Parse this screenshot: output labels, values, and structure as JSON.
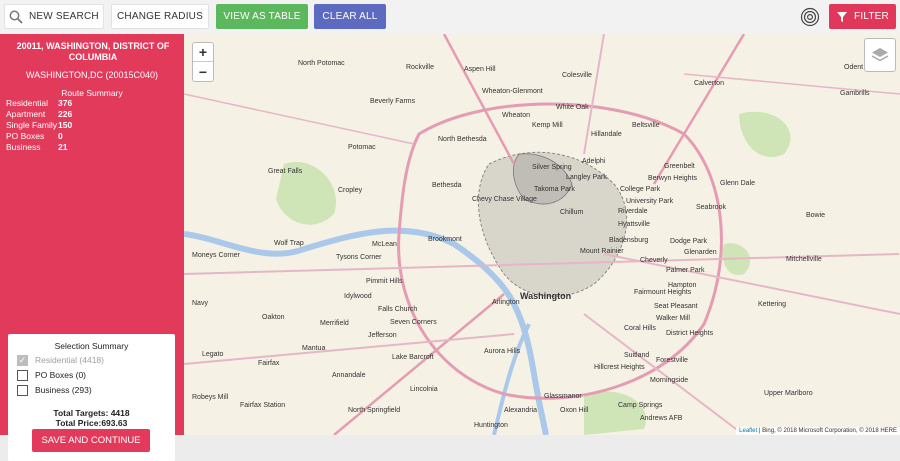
{
  "toolbar": {
    "new_search": "NEW SEARCH",
    "change_radius": "CHANGE RADIUS",
    "view_as_table": "VIEW AS TABLE",
    "clear_all": "CLEAR ALL",
    "filter": "FILTER"
  },
  "sidebar": {
    "address_title": "20011, WASHINGTON, DISTRICT OF COLUMBIA",
    "address_sub": "WASHINGTON,DC (20015C040)",
    "route_summary_title": "Route Summary",
    "routes": [
      {
        "label": "Residential",
        "value": "376"
      },
      {
        "label": "Apartment",
        "value": "226"
      },
      {
        "label": "Single Family",
        "value": "150"
      },
      {
        "label": "PO Boxes",
        "value": "0"
      },
      {
        "label": "Business",
        "value": "21"
      }
    ]
  },
  "selection": {
    "title": "Selection Summary",
    "items": [
      {
        "label": "Residential (4418)",
        "checked": true,
        "disabled": true
      },
      {
        "label": "PO Boxes (0)",
        "checked": false,
        "disabled": false
      },
      {
        "label": "Business (293)",
        "checked": false,
        "disabled": false
      }
    ],
    "total_targets": "Total Targets: 4418",
    "total_price": "Total Price:693.63",
    "save_button": "SAVE AND CONTINUE"
  },
  "map": {
    "zoom_in": "+",
    "zoom_out": "−",
    "attribution_leaflet": "Leaflet",
    "attribution_rest": " | Bing, © 2018 Microsoft Corporation, © 2018 HERE",
    "places": [
      {
        "name": "North Potomac",
        "big": false
      },
      {
        "name": "Rockville",
        "big": false
      },
      {
        "name": "Aspen Hill",
        "big": false
      },
      {
        "name": "Colesville",
        "big": false
      },
      {
        "name": "Calverton",
        "big": false
      },
      {
        "name": "Beverly Farms",
        "big": false
      },
      {
        "name": "Wheaton-Glenmont",
        "big": false
      },
      {
        "name": "White Oak",
        "big": false
      },
      {
        "name": "Wheaton",
        "big": false
      },
      {
        "name": "Kemp Mill",
        "big": false
      },
      {
        "name": "Beltsville",
        "big": false
      },
      {
        "name": "Hillandale",
        "big": false
      },
      {
        "name": "North Bethesda",
        "big": false
      },
      {
        "name": "Potomac",
        "big": false
      },
      {
        "name": "Silver Spring",
        "big": false
      },
      {
        "name": "Adelphi",
        "big": false
      },
      {
        "name": "Greenbelt",
        "big": false
      },
      {
        "name": "Langley Park",
        "big": false
      },
      {
        "name": "Great Falls",
        "big": false
      },
      {
        "name": "Takoma Park",
        "big": false
      },
      {
        "name": "Berwyn Heights",
        "big": false
      },
      {
        "name": "College Park",
        "big": false
      },
      {
        "name": "Bethesda",
        "big": false
      },
      {
        "name": "Cropley",
        "big": false
      },
      {
        "name": "University Park",
        "big": false
      },
      {
        "name": "Glenn Dale",
        "big": false
      },
      {
        "name": "Chevy Chase Village",
        "big": false
      },
      {
        "name": "Riverdale",
        "big": false
      },
      {
        "name": "Chillum",
        "big": false
      },
      {
        "name": "Seabrook",
        "big": false
      },
      {
        "name": "Hyattsville",
        "big": false
      },
      {
        "name": "Bowie",
        "big": false
      },
      {
        "name": "Wolf Trap",
        "big": false
      },
      {
        "name": "McLean",
        "big": false
      },
      {
        "name": "Brookmont",
        "big": false
      },
      {
        "name": "Bladensburg",
        "big": false
      },
      {
        "name": "Dodge Park",
        "big": false
      },
      {
        "name": "Mount Rainier",
        "big": false
      },
      {
        "name": "Glenarden",
        "big": false
      },
      {
        "name": "Moneys Corner",
        "big": false
      },
      {
        "name": "Tysons Corner",
        "big": false
      },
      {
        "name": "Cheverly",
        "big": false
      },
      {
        "name": "Palmer Park",
        "big": false
      },
      {
        "name": "Mitchellville",
        "big": false
      },
      {
        "name": "Pimmit Hills",
        "big": false
      },
      {
        "name": "Idylwood",
        "big": false
      },
      {
        "name": "Washington",
        "big": true
      },
      {
        "name": "Arlington",
        "big": false
      },
      {
        "name": "Hampton",
        "big": false
      },
      {
        "name": "Fairmount Heights",
        "big": false
      },
      {
        "name": "Navy",
        "big": false
      },
      {
        "name": "Falls Church",
        "big": false
      },
      {
        "name": "Seat Pleasant",
        "big": false
      },
      {
        "name": "Kettering",
        "big": false
      },
      {
        "name": "Oakton",
        "big": false
      },
      {
        "name": "Walker Mill",
        "big": false
      },
      {
        "name": "Merrifield",
        "big": false
      },
      {
        "name": "Seven Corners",
        "big": false
      },
      {
        "name": "Coral Hills",
        "big": false
      },
      {
        "name": "Jefferson",
        "big": false
      },
      {
        "name": "District Heights",
        "big": false
      },
      {
        "name": "Mantua",
        "big": false
      },
      {
        "name": "Legato",
        "big": false
      },
      {
        "name": "Aurora Hills",
        "big": false
      },
      {
        "name": "Suitland",
        "big": false
      },
      {
        "name": "Lake Barcroft",
        "big": false
      },
      {
        "name": "Forestville",
        "big": false
      },
      {
        "name": "Fairfax",
        "big": false
      },
      {
        "name": "Annandale",
        "big": false
      },
      {
        "name": "Hillcrest Heights",
        "big": false
      },
      {
        "name": "Morningside",
        "big": false
      },
      {
        "name": "Robeys Mill",
        "big": false
      },
      {
        "name": "Lincolnia",
        "big": false
      },
      {
        "name": "Upper Marlboro",
        "big": false
      },
      {
        "name": "Glassmanor",
        "big": false
      },
      {
        "name": "Fairfax Station",
        "big": false
      },
      {
        "name": "North Springfield",
        "big": false
      },
      {
        "name": "Camp Springs",
        "big": false
      },
      {
        "name": "Alexandria",
        "big": false
      },
      {
        "name": "Oxon Hill",
        "big": false
      },
      {
        "name": "Andrews AFB",
        "big": false
      },
      {
        "name": "Huntington",
        "big": false
      },
      {
        "name": "Odent",
        "big": false
      },
      {
        "name": "Gambrills",
        "big": false
      }
    ]
  }
}
